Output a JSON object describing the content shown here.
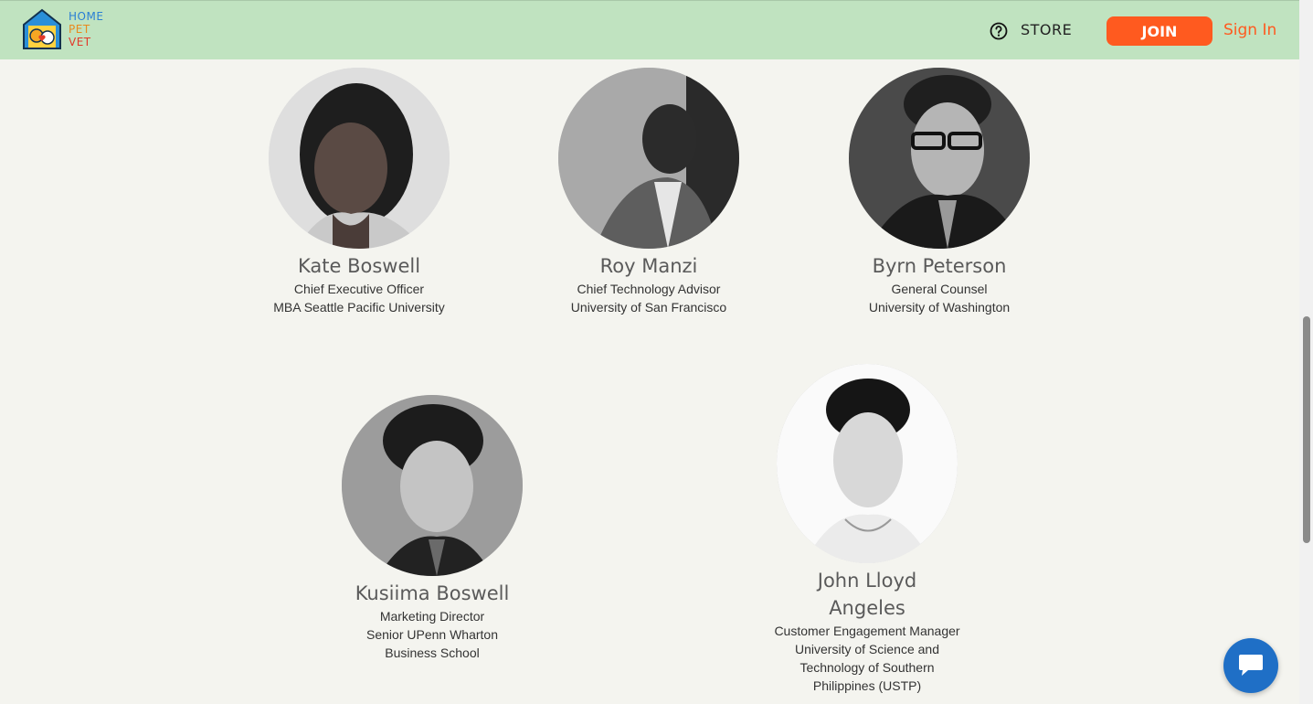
{
  "header": {
    "logo": {
      "line1": "HOME",
      "line2": "PET",
      "line3": "VET"
    },
    "store_label": "STORE",
    "join_label": "JOIN",
    "signin_label": "Sign In"
  },
  "team": [
    {
      "name": "Kate Boswell",
      "role": "Chief Executive Officer",
      "school": "MBA Seattle Pacific University"
    },
    {
      "name": "Roy Manzi",
      "role": "Chief Technology Advisor",
      "school": "University of San Francisco"
    },
    {
      "name": "Byrn Peterson",
      "role": "General Counsel",
      "school": "University of Washington"
    },
    {
      "name": "Kusiima Boswell",
      "role": "Marketing Director",
      "school": "Senior UPenn Wharton Business School"
    },
    {
      "name": "John Lloyd Angeles",
      "role": "Customer Engagement Manager",
      "school": "University of Science and Technology of Southern Philippines (USTP)"
    }
  ],
  "colors": {
    "header_bg": "#c0e3c0",
    "page_bg": "#f4f4ef",
    "accent": "#ff5a1f",
    "chat": "#1f6fc6"
  }
}
